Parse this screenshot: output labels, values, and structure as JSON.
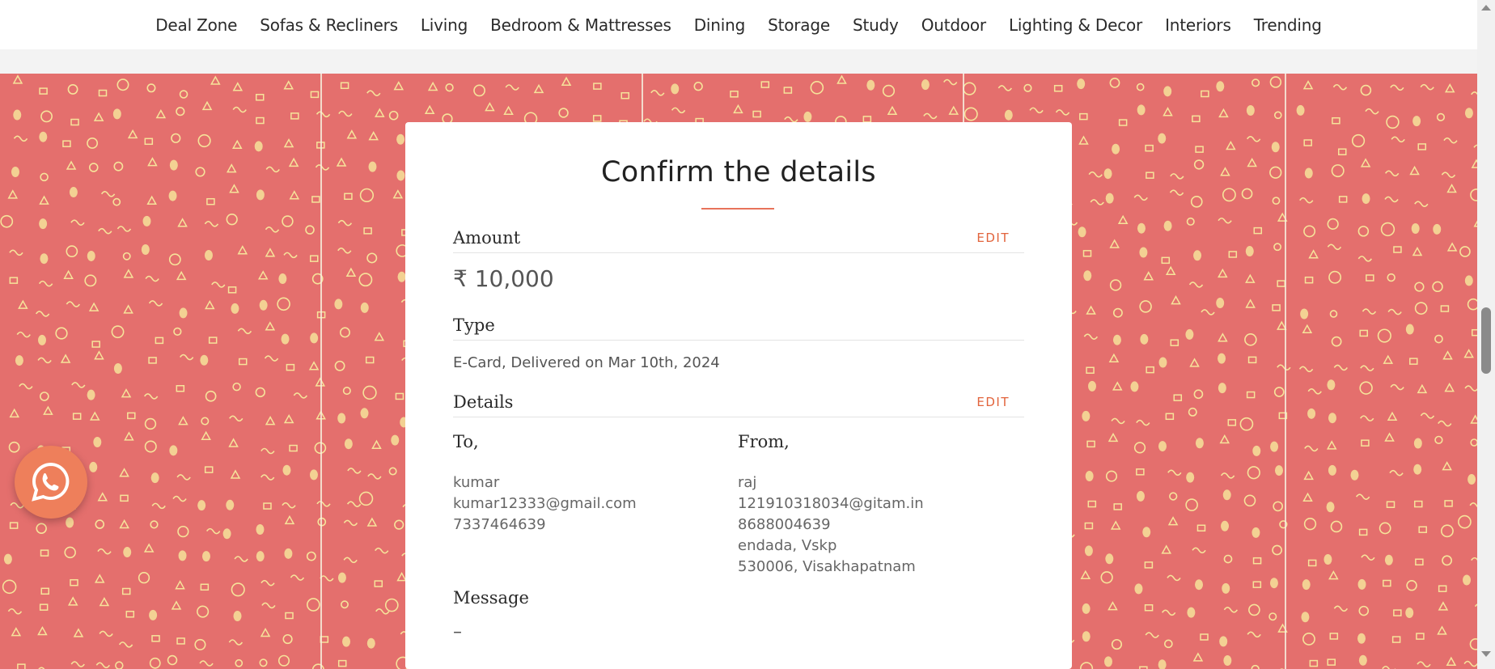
{
  "nav": {
    "items": [
      {
        "label": "Deal Zone"
      },
      {
        "label": "Sofas & Recliners"
      },
      {
        "label": "Living"
      },
      {
        "label": "Bedroom & Mattresses"
      },
      {
        "label": "Dining"
      },
      {
        "label": "Storage"
      },
      {
        "label": "Study"
      },
      {
        "label": "Outdoor"
      },
      {
        "label": "Lighting & Decor"
      },
      {
        "label": "Interiors"
      },
      {
        "label": "Trending"
      }
    ]
  },
  "card": {
    "title": "Confirm the details",
    "amount": {
      "label": "Amount",
      "edit": "EDIT",
      "value": "₹ 10,000"
    },
    "type": {
      "label": "Type",
      "value": "E-Card, Delivered on Mar 10th, 2024"
    },
    "details": {
      "label": "Details",
      "edit": "EDIT",
      "to": {
        "label": "To,",
        "name": "kumar",
        "email": "kumar12333@gmail.com",
        "phone": "7337464639"
      },
      "from": {
        "label": "From,",
        "name": "raj",
        "email": "121910318034@gitam.in",
        "phone": "8688004639",
        "address1": "endada, Vskp",
        "address2": "530006, Visakhapatnam"
      }
    },
    "message": {
      "label": "Message",
      "value": "–"
    }
  },
  "colors": {
    "accent": "#e2643c",
    "pattern_bg": "#e46f6d",
    "pattern_doodle": "#f6e39a",
    "whatsapp_bg": "#ee7f5b"
  },
  "icons": {
    "whatsapp": "whatsapp-icon"
  }
}
